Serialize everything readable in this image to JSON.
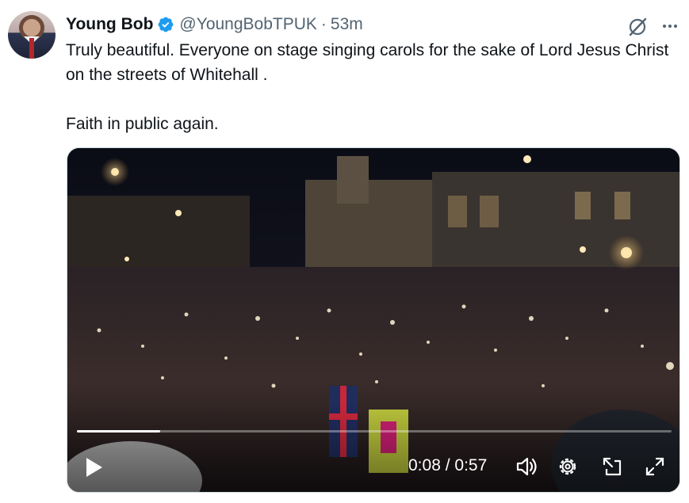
{
  "author": {
    "display_name": "Young Bob",
    "handle": "@YoungBobTPUK",
    "separator": "·",
    "timestamp": "53m",
    "verified": true
  },
  "tweet": {
    "paragraph_1": "Truly beautiful. Everyone on stage singing carols for the sake of Lord Jesus Christ on the streets of Whitehall .",
    "paragraph_2": "Faith in public again."
  },
  "video": {
    "current_time": "0:08",
    "duration": "0:57",
    "time_separator": " / ",
    "progress": 0.14
  },
  "icons": {
    "verified": "verified-badge-icon",
    "grok": "grok-icon",
    "more": "more-icon",
    "play": "play-icon",
    "volume": "volume-icon",
    "settings": "settings-gear-icon",
    "pip": "picture-in-picture-icon",
    "fullscreen": "fullscreen-icon"
  },
  "colors": {
    "verified_blue": "#1d9bf0",
    "text_primary": "#0f1419",
    "text_secondary": "#536471"
  }
}
